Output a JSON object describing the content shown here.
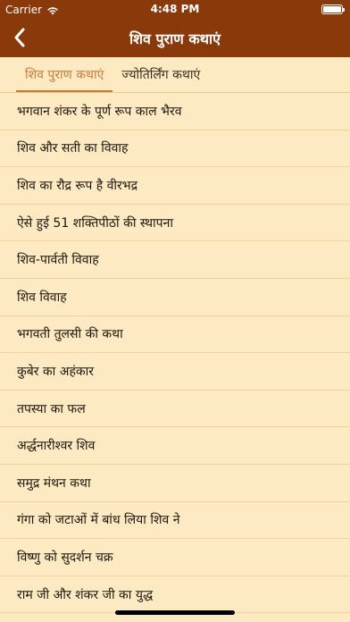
{
  "status_bar": {
    "carrier": "Carrier",
    "time": "4:48 PM"
  },
  "nav": {
    "title": "शिव पुराण कथाएं",
    "back_icon": "chevron-left-icon"
  },
  "tabs": [
    {
      "label": "शिव पुराण कथाएं",
      "active": true
    },
    {
      "label": "ज्योतिर्लिंग कथाएं",
      "active": false
    }
  ],
  "stories": [
    "भगवान शंकर के पूर्ण रूप काल भैरव",
    "शिव और सती का विवाह",
    "शिव का रौद्र रूप है वीरभद्र",
    "ऐसे हुई 51 शक्तिपीठों की स्थापना",
    "शिव-पार्वती विवाह",
    "शिव विवाह",
    "भगवती तुलसी की कथा",
    "कुबेर का अहंकार",
    "तपस्या का फल",
    "अर्द्धनारीश्वर शिव",
    "समुद्र मंथन कथा",
    "गंगा को जटाओं में बांध लिया शिव ने",
    "विष्णु को सुदर्शन चक्र",
    "राम जी और शंकर जी का युद्ध"
  ],
  "colors": {
    "header_bg": "#8a3a0a",
    "page_bg": "#fdeac2",
    "active_tab": "#c87a3a"
  }
}
